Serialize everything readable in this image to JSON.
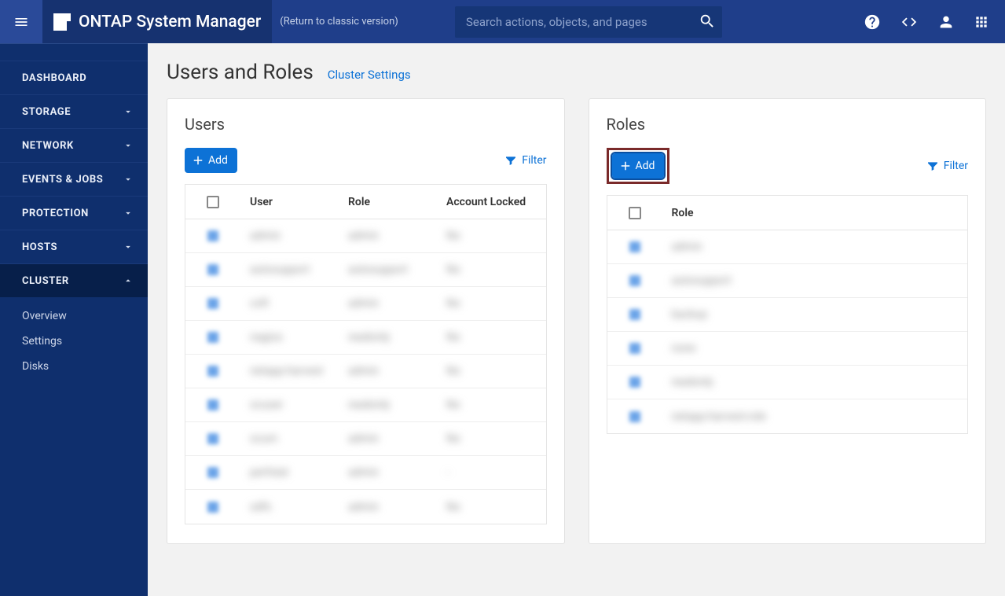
{
  "header": {
    "app_title": "ONTAP System Manager",
    "classic_link": "(Return to classic version)",
    "search_placeholder": "Search actions, objects, and pages"
  },
  "sidebar": {
    "items": [
      {
        "label": "DASHBOARD",
        "expandable": false
      },
      {
        "label": "STORAGE",
        "expandable": true
      },
      {
        "label": "NETWORK",
        "expandable": true
      },
      {
        "label": "EVENTS & JOBS",
        "expandable": true
      },
      {
        "label": "PROTECTION",
        "expandable": true
      },
      {
        "label": "HOSTS",
        "expandable": true
      },
      {
        "label": "CLUSTER",
        "expandable": true,
        "active": true
      }
    ],
    "cluster_sub": [
      {
        "label": "Overview"
      },
      {
        "label": "Settings"
      },
      {
        "label": "Disks"
      }
    ]
  },
  "page": {
    "title": "Users and Roles",
    "breadcrumb": "Cluster Settings"
  },
  "users_panel": {
    "title": "Users",
    "add_label": "Add",
    "filter_label": "Filter",
    "columns": {
      "user": "User",
      "role": "Role",
      "locked": "Account Locked"
    },
    "rows": [
      {
        "user": "admin",
        "role": "admin",
        "locked": "No"
      },
      {
        "user": "autosupport",
        "role": "autosupport",
        "locked": "No"
      },
      {
        "user": "csft",
        "role": "admin",
        "locked": "No"
      },
      {
        "user": "nagios",
        "role": "readonly",
        "locked": "No"
      },
      {
        "user": "netapp-harvest",
        "role": "admin",
        "locked": "No"
      },
      {
        "user": "ocuser",
        "role": "readonly",
        "locked": "No"
      },
      {
        "user": "ocum",
        "role": "admin",
        "locked": "No"
      },
      {
        "user": "perfstat",
        "role": "admin",
        "locked": "-"
      },
      {
        "user": "sdfs",
        "role": "admin",
        "locked": "No"
      }
    ]
  },
  "roles_panel": {
    "title": "Roles",
    "add_label": "Add",
    "filter_label": "Filter",
    "columns": {
      "role": "Role"
    },
    "rows": [
      {
        "role": "admin"
      },
      {
        "role": "autosupport"
      },
      {
        "role": "backup"
      },
      {
        "role": "none"
      },
      {
        "role": "readonly"
      },
      {
        "role": "netapp-harvest-role"
      }
    ]
  }
}
